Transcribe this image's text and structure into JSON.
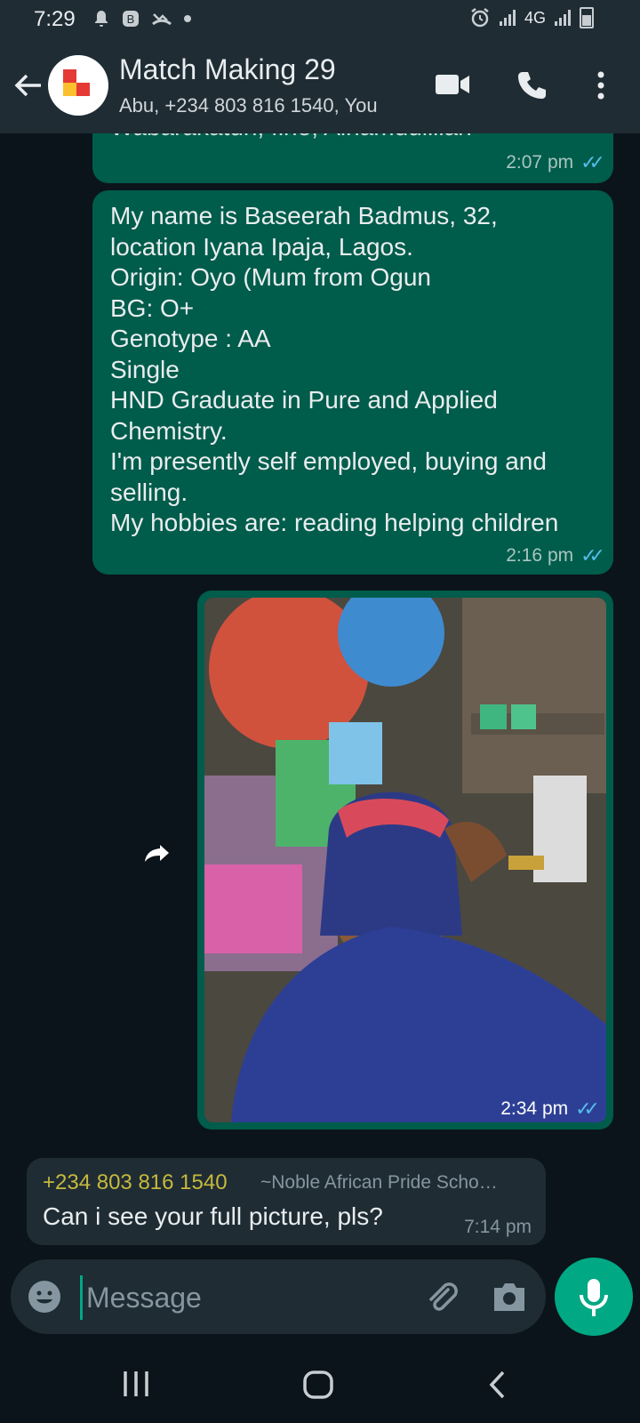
{
  "status_bar": {
    "time": "7:29",
    "network": "4G"
  },
  "header": {
    "back_icon": "arrow-left-icon",
    "title": "Match Making 29",
    "subtitle": "Abu, +234 803 816 1540, You",
    "actions": [
      "video-call-icon",
      "voice-call-icon",
      "more-vert-icon"
    ]
  },
  "messages": {
    "prev": {
      "partial_text": "Wabarakatuh, fine, Alhamdulillah",
      "time": "2:07 pm"
    },
    "intro": {
      "text": "My name is Baseerah Badmus, 32,\nlocation Iyana Ipaja, Lagos.\nOrigin: Oyo (Mum from Ogun\nBG: O+\nGenotype : AA\nSingle\nHND Graduate in Pure and Applied\nChemistry.\nI'm presently self employed, buying and\nselling.\nMy hobbies are: reading helping children",
      "time": "2:16 pm"
    },
    "photo": {
      "time": "2:34 pm",
      "forward_icon": "forward-icon"
    },
    "incoming": {
      "sender": "+234 803 816 1540",
      "pushname": "~Noble African Pride Scho…",
      "text": "Can i see your full picture, pls?",
      "time": "7:14 pm"
    }
  },
  "composer": {
    "placeholder": "Message"
  },
  "colors": {
    "bubble_out": "#005c4b",
    "bubble_in": "#1f2c34",
    "accent": "#00a884",
    "read_tick": "#53bdeb"
  }
}
